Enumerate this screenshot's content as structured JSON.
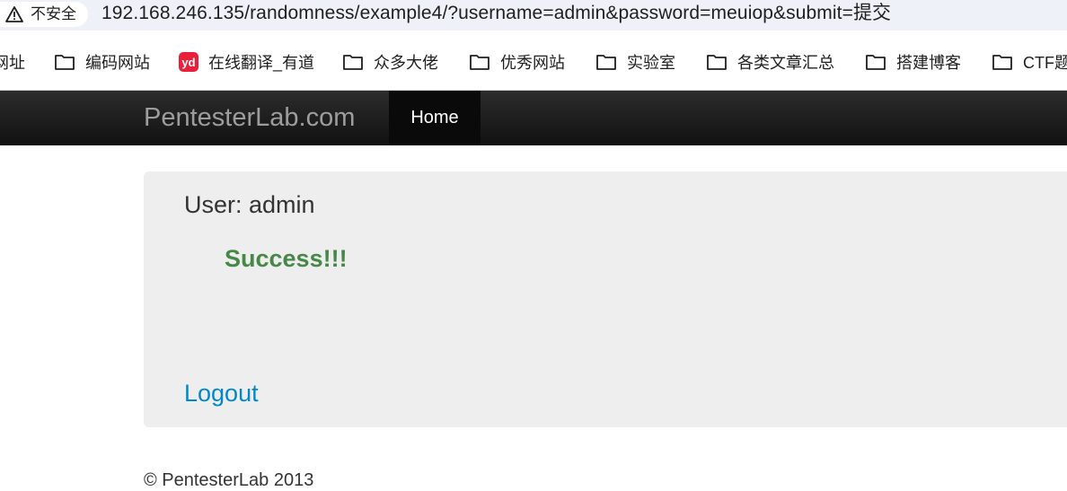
{
  "browser": {
    "security_label": "不安全",
    "url": "192.168.246.135/randomness/example4/?username=admin&password=meuiop&submit=提交"
  },
  "bookmarks": [
    {
      "label": "网址",
      "icon": "folder-icon"
    },
    {
      "label": "编码网站",
      "icon": "folder-icon"
    },
    {
      "label": "在线翻译_有道",
      "icon": "youdao-icon",
      "icon_text": "yd"
    },
    {
      "label": "众多大佬",
      "icon": "folder-icon"
    },
    {
      "label": "优秀网站",
      "icon": "folder-icon"
    },
    {
      "label": "实验室",
      "icon": "folder-icon"
    },
    {
      "label": "各类文章汇总",
      "icon": "folder-icon"
    },
    {
      "label": "搭建博客",
      "icon": "folder-icon"
    },
    {
      "label": "CTF题",
      "icon": "folder-icon"
    }
  ],
  "navbar": {
    "brand": "PentesterLab.com",
    "home": "Home"
  },
  "content": {
    "user_line": "User: admin",
    "status": "Success!!!",
    "logout": "Logout"
  },
  "footer": {
    "copyright": "© PentesterLab 2013"
  },
  "colors": {
    "navbar": "#1b1b1b",
    "success": "#468847",
    "link": "#0088cc",
    "well": "#eeeeee"
  }
}
